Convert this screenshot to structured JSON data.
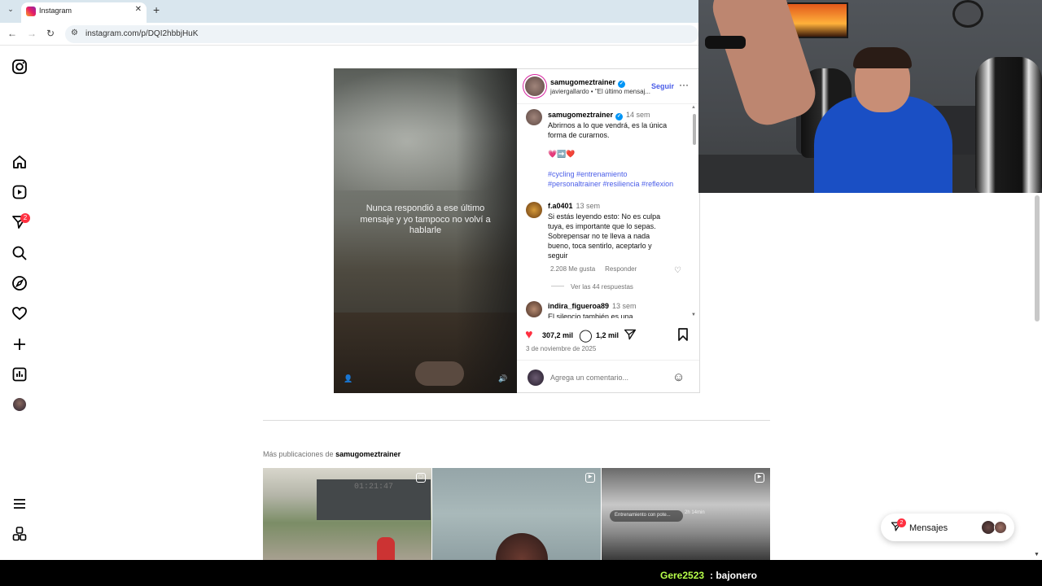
{
  "browser": {
    "tab_title": "Instagram",
    "tab_close": "✕",
    "new_tab": "+",
    "url": "instagram.com/p/DQI2hbbjHuK"
  },
  "rail": {
    "notification_count": "2"
  },
  "post": {
    "media_text": "Nunca respondió a ese último mensaje y yo tampoco no volví a hablarle",
    "author": "samugomeztrainer",
    "subtitle": "javiergallardo • \"El último mensaj...",
    "follow_label": "Seguir",
    "caption": {
      "user": "samugomeztrainer",
      "time": "14 sem",
      "text": "Abrirnos a lo que vendrá, es la única forma de curarnos.",
      "emojis": "💗➡️❤️",
      "tags_line1": "#cycling #entrenamiento",
      "tags_line2": "#personaltrainer #resiliencia #reflexion"
    },
    "comments": [
      {
        "user": "f.a0401",
        "time": "13 sem",
        "text": "Si estás leyendo esto: No es culpa tuya, es importante que lo sepas. Sobrepensar no te lleva a nada bueno, toca sentirlo, aceptarlo y seguir",
        "likes": "2.208 Me gusta",
        "reply_label": "Responder",
        "view_replies": "Ver las 44 respuestas"
      },
      {
        "user": "indira_figueroa89",
        "time": "13 sem",
        "text": "El silencio también es una"
      }
    ],
    "likes_count": "307,2 mil",
    "comments_count": "1,2 mil",
    "date": "3 de noviembre de 2025",
    "add_comment_placeholder": "Agrega un comentario..."
  },
  "more_posts": {
    "prefix": "Más publicaciones de",
    "user": "samugomeztrainer",
    "thumb1_board": "01:21:47",
    "thumb3_chip": "Entrenamiento con pote...",
    "thumb3_stat": "2h 14min"
  },
  "messages": {
    "label": "Mensajes",
    "badge": "2"
  },
  "chat": {
    "user": "Gere2523",
    "message": ": bajonero"
  },
  "colors": {
    "accent_link": "#4a5de8",
    "like_red": "#ff3040",
    "badge_red": "#ff3040",
    "chat_user": "#b7ff4a"
  }
}
